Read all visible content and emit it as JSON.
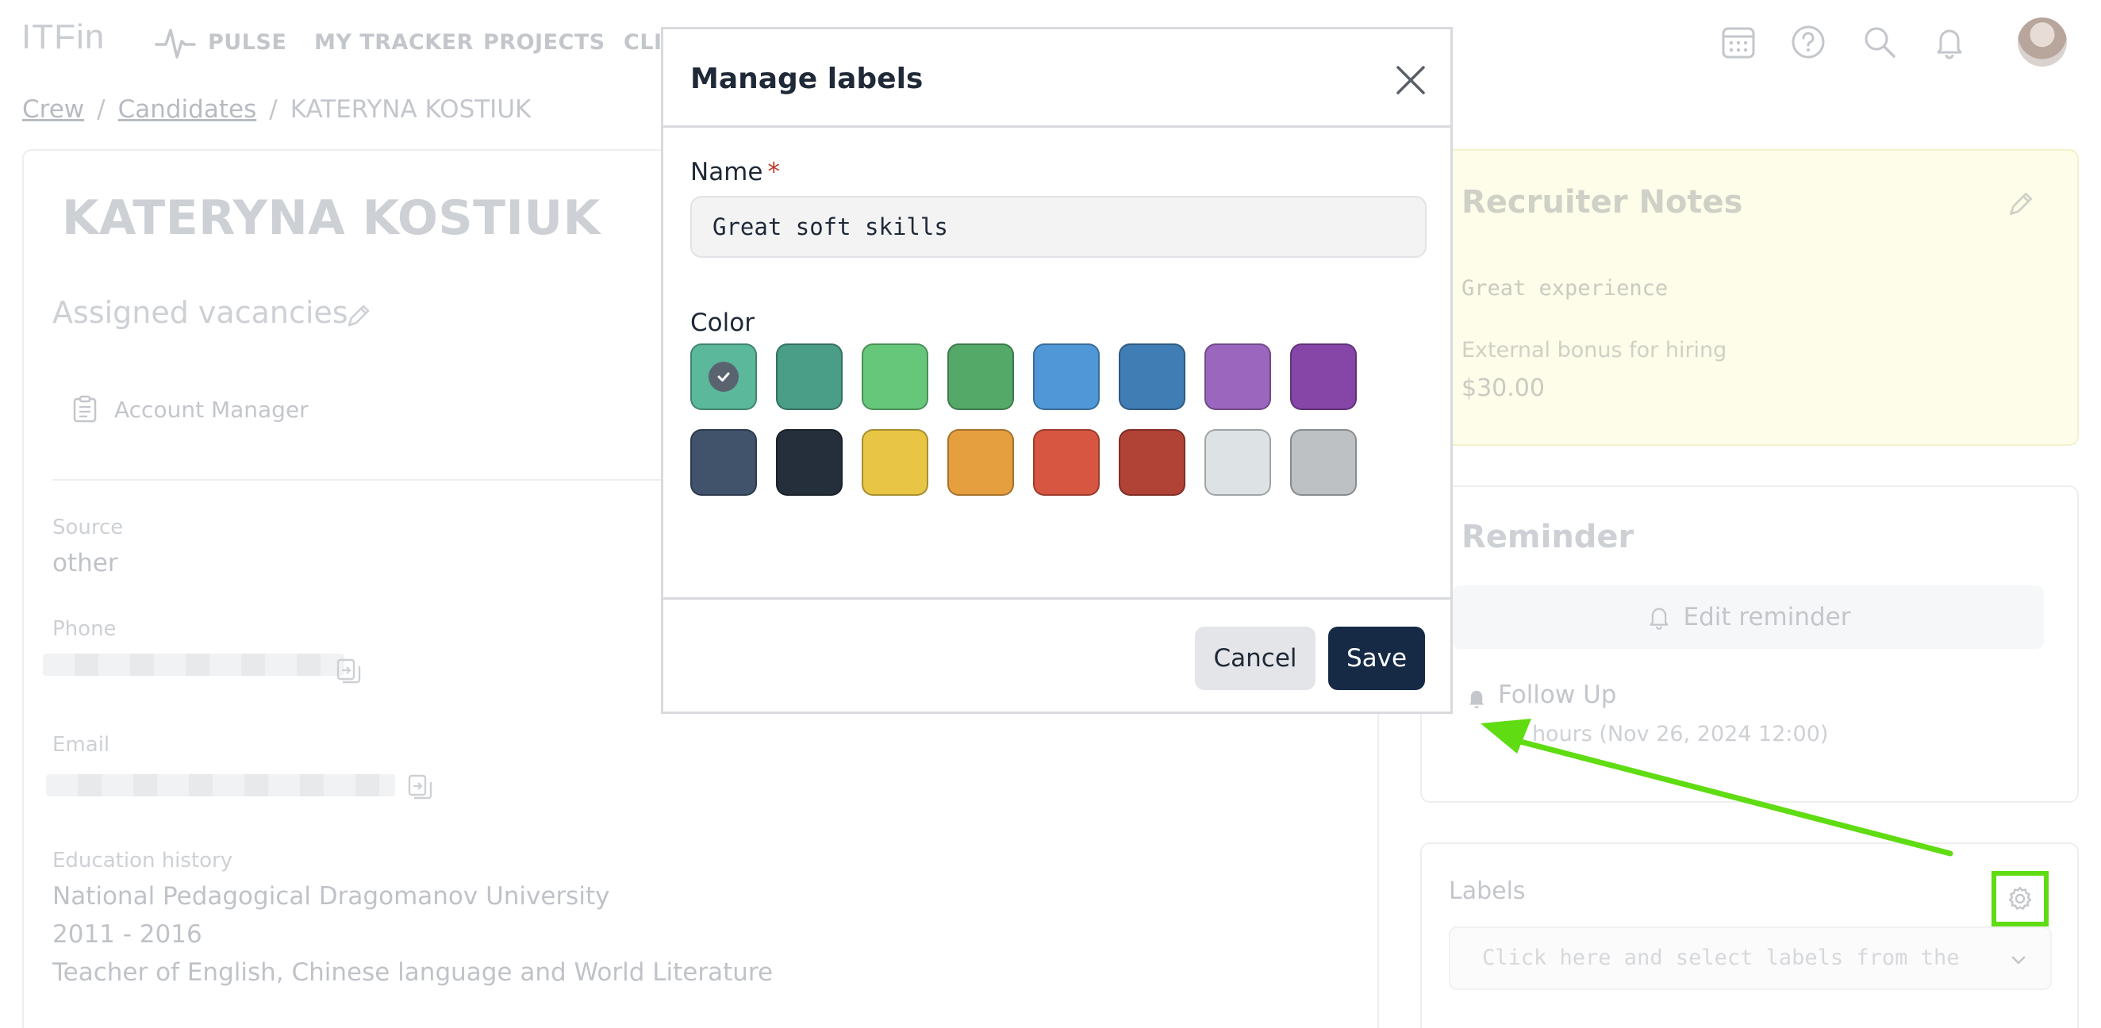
{
  "app": {
    "logo": "ITFin"
  },
  "nav": {
    "items": [
      "PULSE",
      "MY TRACKER",
      "PROJECTS",
      "CLIE"
    ]
  },
  "breadcrumb": {
    "crew": "Crew",
    "candidates": "Candidates",
    "current": "KATERYNA KOSTIUK"
  },
  "candidate": {
    "name": "KATERYNA KOSTIUK",
    "assigned_title": "Assigned vacancies",
    "vacancy": "Account Manager",
    "source_label": "Source",
    "source_value": "other",
    "phone_label": "Phone",
    "email_label": "Email",
    "education_label": "Education history",
    "education": [
      "National Pedagogical Dragomanov University",
      "2011 - 2016",
      "Teacher of English, Chinese language and World Literature"
    ]
  },
  "notes": {
    "title": "Recruiter Notes",
    "text": "Great experience",
    "bonus_label": "External bonus for hiring",
    "bonus_value": "$30.00"
  },
  "reminder": {
    "title": "Reminder",
    "edit_label": "Edit reminder",
    "follow_label": "Follow Up",
    "follow_time": "11 hours (Nov 26, 2024 12:00)"
  },
  "labels": {
    "title": "Labels",
    "placeholder": "Click here and select labels from the"
  },
  "modal": {
    "title": "Manage labels",
    "name_label": "Name",
    "required_mark": "*",
    "name_value": "Great soft skills",
    "color_label": "Color",
    "selected_color": "#5bb89a",
    "colors": [
      "#5bb89a",
      "#4a9d86",
      "#66c77a",
      "#55a968",
      "#4f97d6",
      "#417db5",
      "#9b66be",
      "#8646a8",
      "#41526b",
      "#252f3b",
      "#e8c544",
      "#e59f3f",
      "#d75642",
      "#b04236",
      "#dde3e4",
      "#bdc1c4"
    ],
    "cancel_label": "Cancel",
    "save_label": "Save"
  },
  "annotation": {
    "highlight_color": "#5fdc12"
  }
}
